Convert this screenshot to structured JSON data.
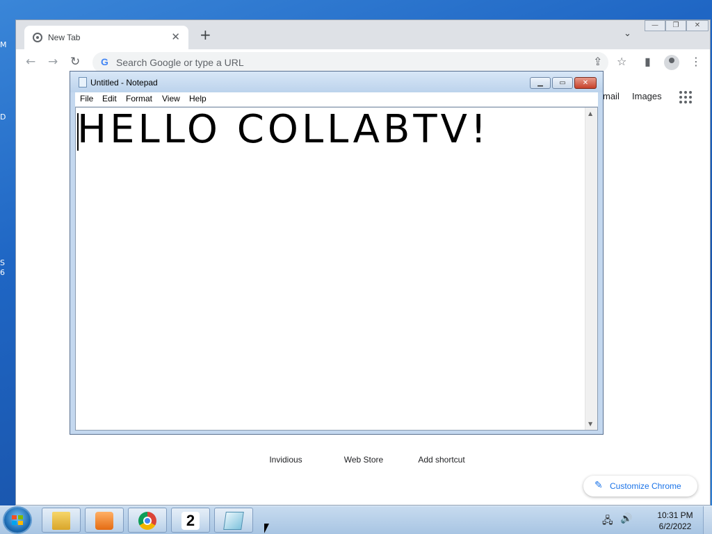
{
  "desktop": {
    "sliver_letters": [
      "M",
      "D",
      "S",
      "6"
    ]
  },
  "chrome": {
    "tab": {
      "title": "New Tab",
      "close_label": "✕"
    },
    "new_tab_label": "+",
    "tab_search_label": "⌄",
    "window_buttons": {
      "minimize": "—",
      "restore": "❐",
      "close": "✕"
    },
    "nav": {
      "back": "←",
      "forward": "→",
      "reload": "↻"
    },
    "omnibox": {
      "g_logo": "G",
      "placeholder": "Search Google or type a URL"
    },
    "toolbar_icons": [
      "share-icon",
      "star-icon",
      "side-panel-icon",
      "profile-icon",
      "menu-icon"
    ],
    "top_links": [
      "mail",
      "Images"
    ],
    "shortcuts": [
      "Invidious",
      "Web Store",
      "Add shortcut"
    ],
    "customize_label": "Customize Chrome"
  },
  "notepad": {
    "title": "Untitled - Notepad",
    "menu": [
      "File",
      "Edit",
      "Format",
      "View",
      "Help"
    ],
    "content": "HELLO COLLABTV!"
  },
  "taskbar": {
    "apps": [
      "file-explorer-icon",
      "media-player-icon",
      "chrome-icon",
      "app-2-icon",
      "notepad-icon"
    ],
    "app2_label": "2",
    "clock_time": "10:31 PM",
    "clock_date": "6/2/2022"
  }
}
